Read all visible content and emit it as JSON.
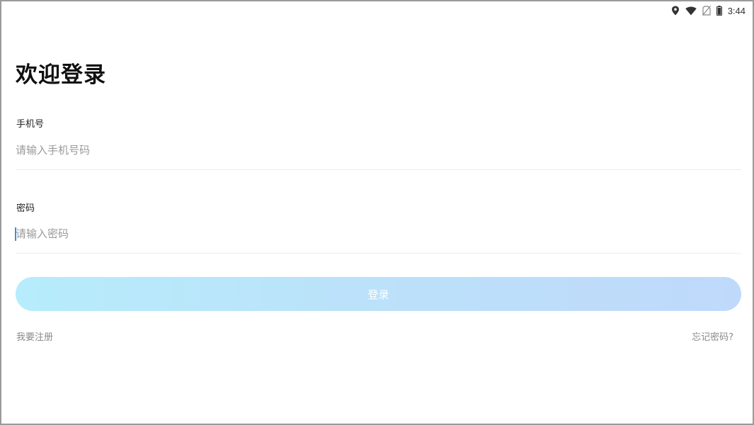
{
  "status_bar": {
    "time": "3:44",
    "icons": [
      "location-icon",
      "wifi-icon",
      "no-sim-icon",
      "battery-icon"
    ]
  },
  "login": {
    "title": "欢迎登录",
    "phone_label": "手机号",
    "phone_placeholder": "请输入手机号码",
    "phone_value": "",
    "password_label": "密码",
    "password_placeholder": "请输入密码",
    "password_value": "",
    "login_button": "登录",
    "register_link": "我要注册",
    "forgot_link": "忘记密码?"
  },
  "colors": {
    "button_gradient_start": "#b6ecfb",
    "button_gradient_end": "#bfd9fb",
    "cursor": "#3a8ee6",
    "title_text": "#111111",
    "link_text": "#8a8a8a"
  }
}
